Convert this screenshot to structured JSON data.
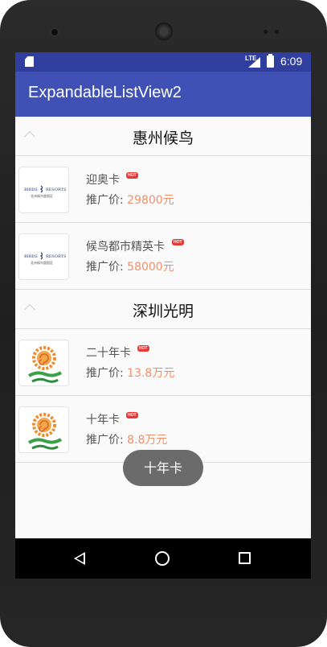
{
  "status_bar": {
    "network": "LTE",
    "time": "6:09",
    "icons": [
      "sd-card-icon",
      "signal-icon",
      "battery-icon"
    ]
  },
  "app_bar": {
    "title": "ExpandableListView2"
  },
  "groups": [
    {
      "title": "惠州候鸟",
      "children": [
        {
          "name": "迎奥卡",
          "badge": "HOT",
          "price_label": "推广价:",
          "price": "29800元",
          "thumb_text": [
            "BIRDS",
            "RESORTS",
            "北州候鸟度假区"
          ]
        },
        {
          "name": "候鸟都市精英卡",
          "badge": "HOT",
          "price_label": "推广价:",
          "price": "58000元",
          "thumb_text": [
            "BIRDS",
            "RESORTS",
            "北州候鸟度假区"
          ]
        }
      ]
    },
    {
      "title": "深圳光明",
      "children": [
        {
          "name": "二十年卡",
          "badge": "HOT",
          "price_label": "推广价:",
          "price": "13.8万元"
        },
        {
          "name": "十年卡",
          "badge": "HOT",
          "price_label": "推广价:",
          "price": "8.8万元"
        }
      ]
    }
  ],
  "toast": {
    "text": "十年卡"
  },
  "colors": {
    "status_bar": "#303f9f",
    "app_bar": "#3f51b5",
    "price": "#f0906a",
    "badge": "#e53935",
    "toast": "#6b6b6b"
  },
  "nav_bar": {
    "icons": [
      "back-icon",
      "home-icon",
      "recents-icon"
    ]
  }
}
